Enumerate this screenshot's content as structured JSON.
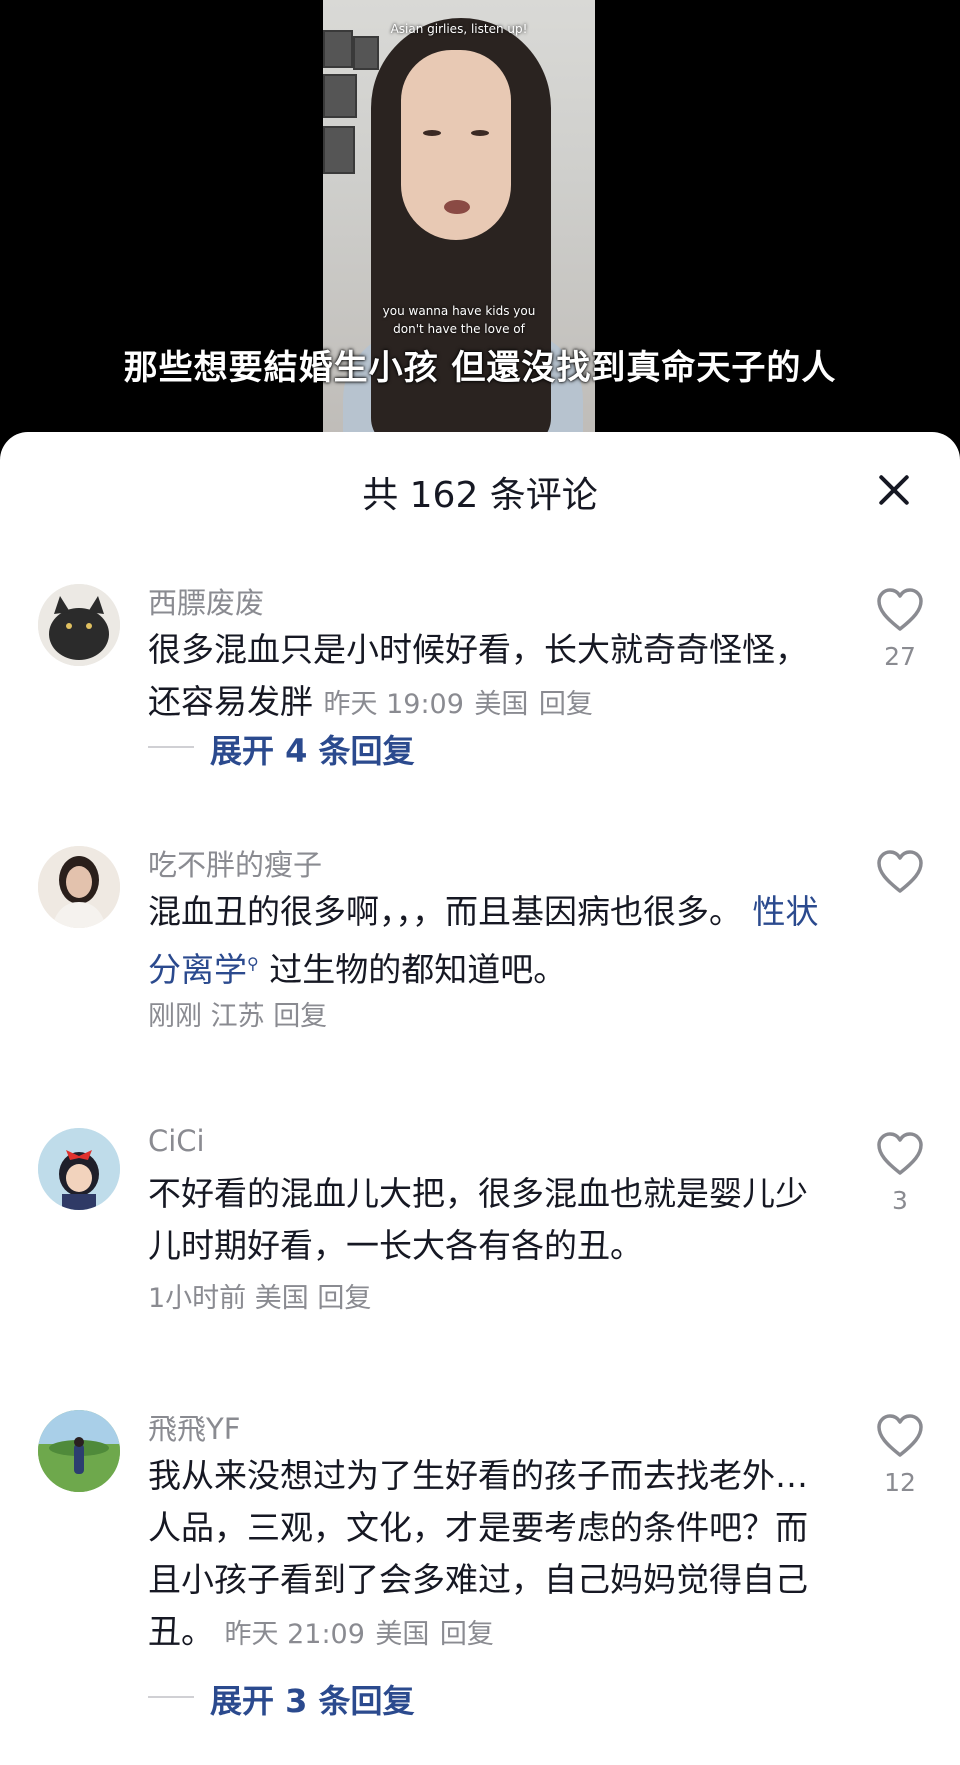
{
  "video": {
    "top_caption": "Asian girlies, listen up!",
    "small_caption": "you wanna have kids you\ndon't have the love of",
    "subtitle": "那些想要結婚生小孩 但還沒找到真命天子的人"
  },
  "sheet": {
    "title": "共 162 条评论",
    "close_icon": "close-icon"
  },
  "comments": [
    {
      "username": "西膘废废",
      "text": "很多混血只是小时候好看，长大就奇奇怪怪，还容易发胖",
      "time": "昨天 19:09",
      "location": "美国",
      "reply": "回复",
      "likes": "27",
      "expand": "展开 4 条回复"
    },
    {
      "username": "吃不胖的瘦子",
      "text_before": "混血丑的很多啊，，，而且基因病也很多。",
      "tag": "性状分离学",
      "text_after": "过生物的都知道吧。",
      "time": "刚刚",
      "location": "江苏",
      "reply": "回复",
      "likes": ""
    },
    {
      "username": "CiCi",
      "text": "不好看的混血儿大把，很多混血也就是婴儿少儿时期好看，一长大各有各的丑。",
      "time": "1小时前",
      "location": "美国",
      "reply": "回复",
      "likes": "3"
    },
    {
      "username": "飛飛YF",
      "text": "我从来没想过为了生好看的孩子而去找老外…人品，三观，文化，才是要考虑的条件吧？而且小孩子看到了会多难过，自己妈妈觉得自己丑。",
      "time": "昨天 21:09",
      "location": "美国",
      "reply": "回复",
      "likes": "12",
      "expand": "展开 3 条回复"
    }
  ],
  "colors": {
    "text": "#161823",
    "meta": "#8a8b91",
    "link": "#2b4a8e"
  }
}
